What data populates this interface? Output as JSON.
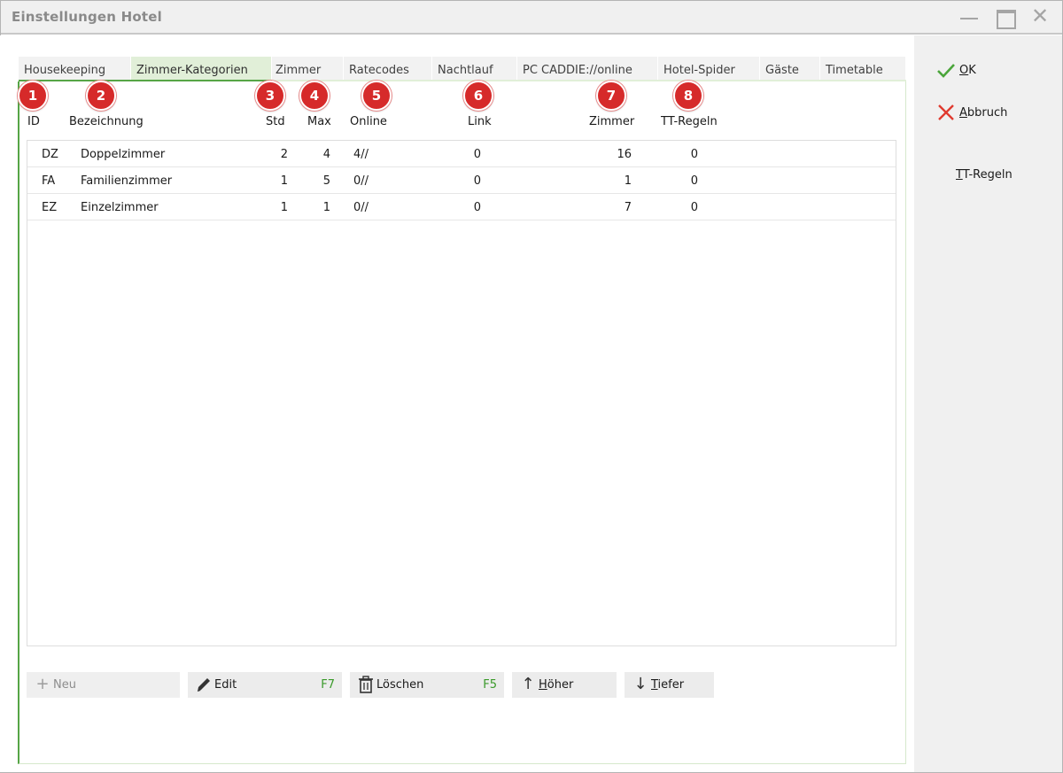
{
  "window": {
    "title": "Einstellungen Hotel"
  },
  "tabs": [
    {
      "label": "Housekeeping"
    },
    {
      "label": "Zimmer-Kategorien"
    },
    {
      "label": "Zimmer"
    },
    {
      "label": "Ratecodes"
    },
    {
      "label": "Nachtlauf"
    },
    {
      "label": "PC CADDIE://online"
    },
    {
      "label": "Hotel-Spider"
    },
    {
      "label": "Gäste"
    },
    {
      "label": "Timetable"
    }
  ],
  "active_tab": "Zimmer-Kategorien",
  "badges": [
    "1",
    "2",
    "3",
    "4",
    "5",
    "6",
    "7",
    "8"
  ],
  "columns": [
    "ID",
    "Bezeichnung",
    "Std",
    "Max",
    "Online",
    "Link",
    "Zimmer",
    "TT-Regeln"
  ],
  "rows": [
    {
      "id": "DZ",
      "name": "Doppelzimmer",
      "std": "2",
      "max": "4",
      "online": "4//",
      "link": "0",
      "zimmer": "16",
      "tt": "0"
    },
    {
      "id": "FA",
      "name": "Familienzimmer",
      "std": "1",
      "max": "5",
      "online": "0//",
      "link": "0",
      "zimmer": "1",
      "tt": "0"
    },
    {
      "id": "EZ",
      "name": "Einzelzimmer",
      "std": "1",
      "max": "1",
      "online": "0//",
      "link": "0",
      "zimmer": "7",
      "tt": "0"
    }
  ],
  "toolbar": {
    "new_label": "Neu",
    "edit_label": "Edit",
    "edit_key": "F7",
    "delete_label": "Löschen",
    "delete_key": "F5",
    "up_label_first": "H",
    "up_label_rest": "öher",
    "down_label_first": "T",
    "down_label_rest": "iefer"
  },
  "side": {
    "ok_first": "O",
    "ok_rest": "K",
    "cancel_first": "A",
    "cancel_rest": "bbruch",
    "tt_first": "T",
    "tt_rest": "T-Regeln"
  },
  "colors": {
    "accent_green": "#56a546",
    "badge_red": "#d62a2a",
    "active_tab_bg": "#e1efd8",
    "hotkey_green": "#3a9a2a"
  }
}
